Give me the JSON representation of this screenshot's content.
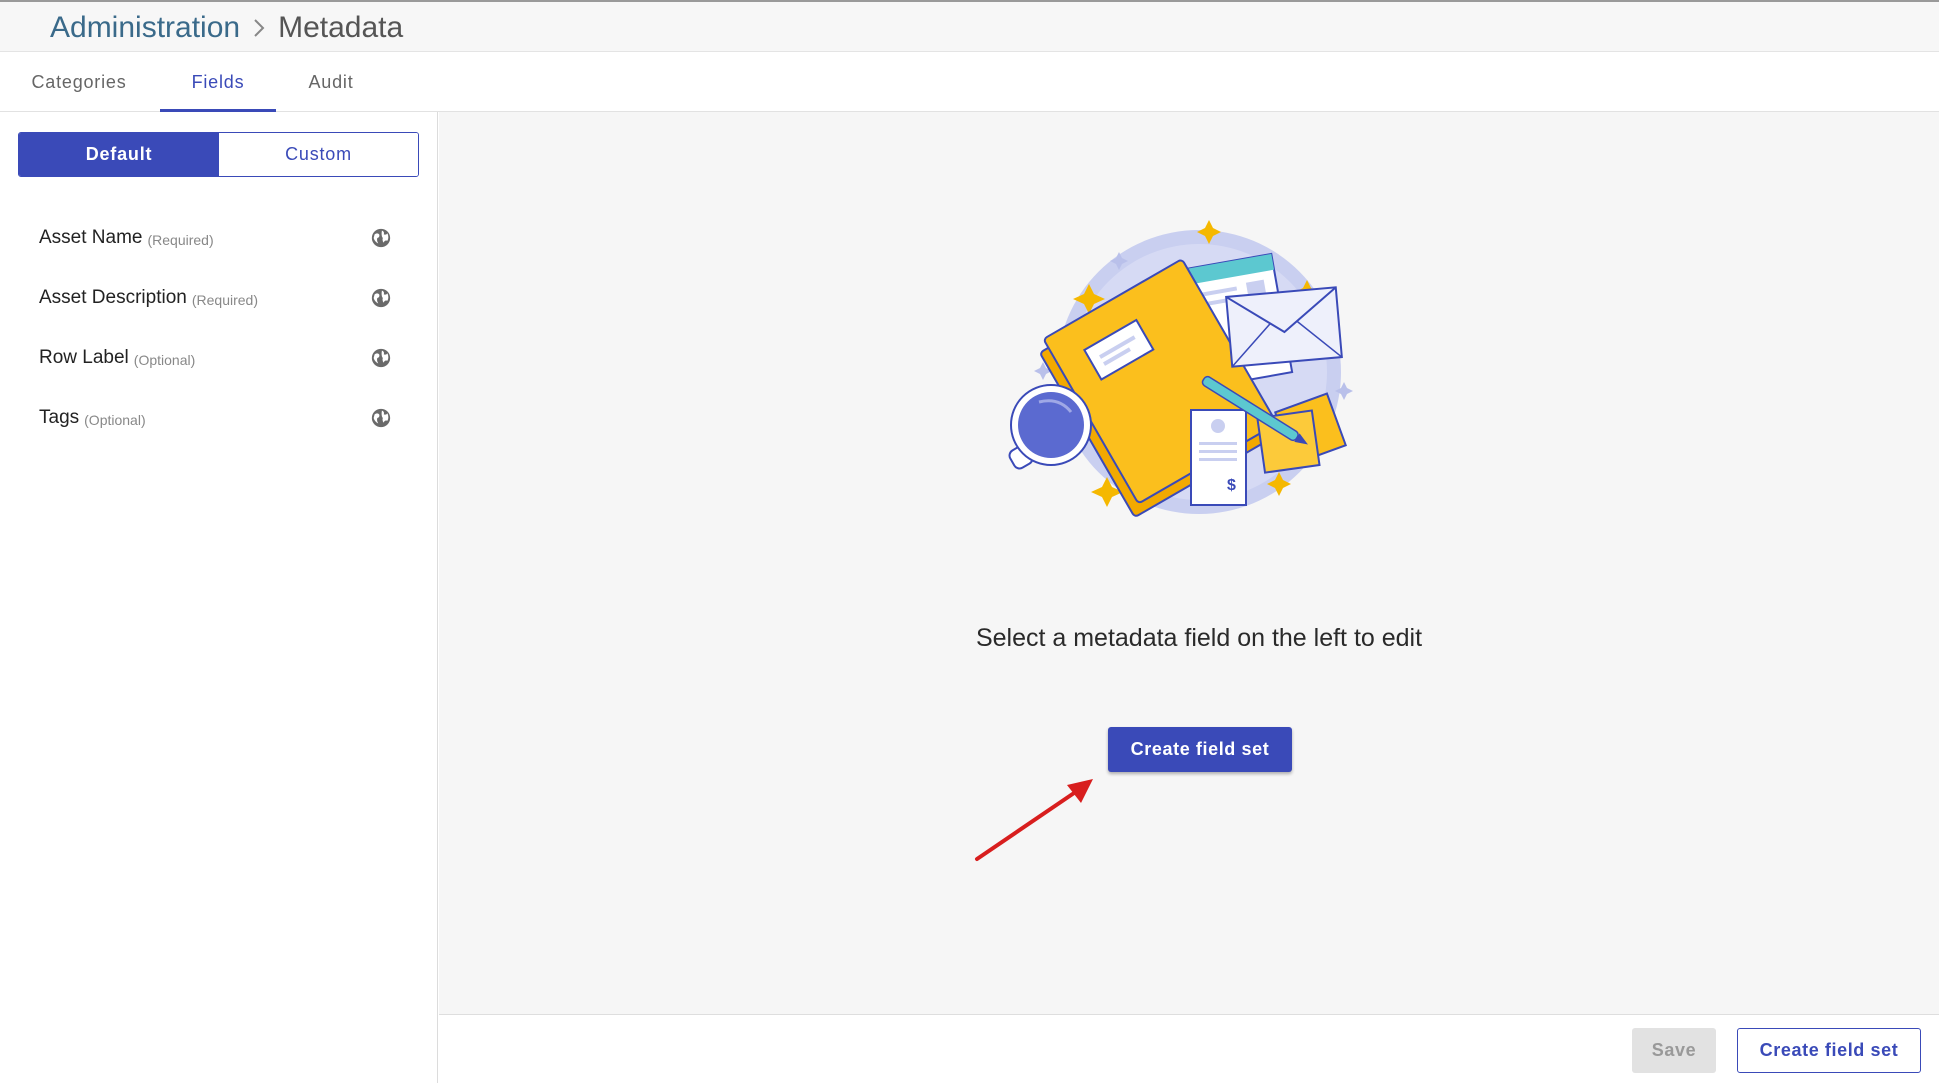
{
  "header": {
    "breadcrumb": [
      {
        "label": "Administration"
      },
      {
        "label": "Metadata"
      }
    ]
  },
  "tabs": [
    {
      "label": "Categories"
    },
    {
      "label": "Fields"
    },
    {
      "label": "Audit"
    }
  ],
  "sidebar": {
    "toggle": {
      "default_label": "Default",
      "custom_label": "Custom"
    },
    "fields": [
      {
        "name": "Asset Name",
        "note": "(Required)",
        "icon": "globe-icon"
      },
      {
        "name": "Asset Description",
        "note": "(Required)",
        "icon": "globe-icon"
      },
      {
        "name": "Row Label",
        "note": "(Optional)",
        "icon": "globe-icon"
      },
      {
        "name": "Tags",
        "note": "(Optional)",
        "icon": "globe-icon"
      }
    ]
  },
  "main": {
    "empty_message": "Select a metadata field on the left to edit",
    "create_button": "Create field set"
  },
  "footer": {
    "save_label": "Save",
    "create_label": "Create field set"
  },
  "colors": {
    "accent": "#3a4ab8",
    "annotation_arrow": "#d81e1e",
    "folder": "#fbbf1d"
  }
}
